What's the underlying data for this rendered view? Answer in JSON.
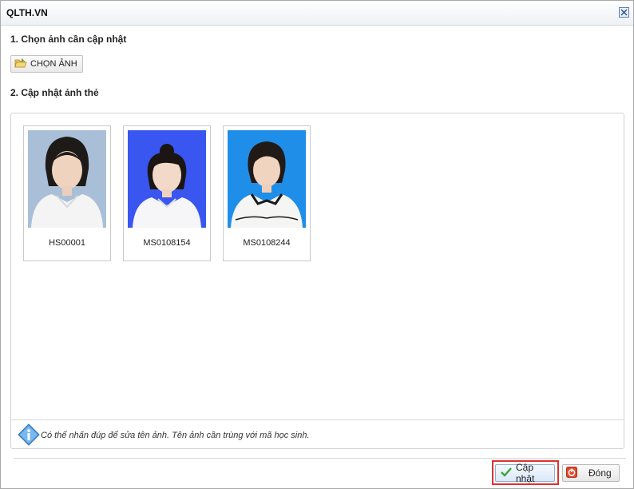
{
  "window": {
    "title": "QLTH.VN"
  },
  "section1": {
    "title": "1. Chọn ảnh cần cập nhật",
    "choose_button": "CHỌN ẢNH"
  },
  "section2": {
    "title": "2. Cập nhật ảnh thẻ"
  },
  "photos": [
    {
      "code": "HS00001",
      "background": "#a9bfd8"
    },
    {
      "code": "MS0108154",
      "background": "#3a56f0"
    },
    {
      "code": "MS0108244",
      "background": "#1f8ee8"
    }
  ],
  "info": {
    "text": "Có thể nhấn đúp để sửa tên ảnh. Tên ảnh cần trùng với mã học sinh."
  },
  "footer": {
    "update_button": "Cập nhật",
    "close_button": "Đóng"
  },
  "colors": {
    "highlight": "#e0312b",
    "accent": "#5b7fb5"
  }
}
